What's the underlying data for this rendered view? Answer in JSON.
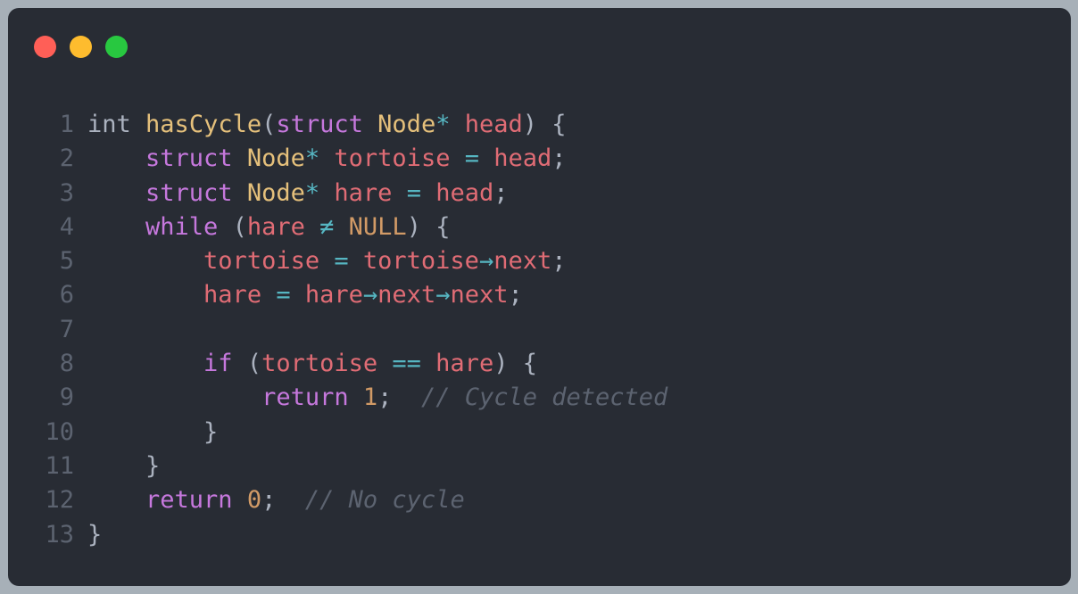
{
  "window": {
    "controls": [
      "close",
      "minimize",
      "maximize"
    ]
  },
  "code": {
    "language": "c",
    "lines": [
      {
        "number": "1",
        "tokens": [
          {
            "t": "int",
            "c": "pl"
          },
          {
            "t": " ",
            "c": "pl"
          },
          {
            "t": "hasCycle",
            "c": "fn"
          },
          {
            "t": "(",
            "c": "pn"
          },
          {
            "t": "struct",
            "c": "kw"
          },
          {
            "t": " ",
            "c": "pl"
          },
          {
            "t": "Node",
            "c": "ty"
          },
          {
            "t": "*",
            "c": "op"
          },
          {
            "t": " ",
            "c": "pl"
          },
          {
            "t": "head",
            "c": "id"
          },
          {
            "t": ") {",
            "c": "pn"
          }
        ]
      },
      {
        "number": "2",
        "tokens": [
          {
            "t": "    ",
            "c": "pl"
          },
          {
            "t": "struct",
            "c": "kw"
          },
          {
            "t": " ",
            "c": "pl"
          },
          {
            "t": "Node",
            "c": "ty"
          },
          {
            "t": "*",
            "c": "op"
          },
          {
            "t": " ",
            "c": "pl"
          },
          {
            "t": "tortoise",
            "c": "id"
          },
          {
            "t": " ",
            "c": "pl"
          },
          {
            "t": "=",
            "c": "op"
          },
          {
            "t": " ",
            "c": "pl"
          },
          {
            "t": "head",
            "c": "id"
          },
          {
            "t": ";",
            "c": "pn"
          }
        ]
      },
      {
        "number": "3",
        "tokens": [
          {
            "t": "    ",
            "c": "pl"
          },
          {
            "t": "struct",
            "c": "kw"
          },
          {
            "t": " ",
            "c": "pl"
          },
          {
            "t": "Node",
            "c": "ty"
          },
          {
            "t": "*",
            "c": "op"
          },
          {
            "t": " ",
            "c": "pl"
          },
          {
            "t": "hare",
            "c": "id"
          },
          {
            "t": " ",
            "c": "pl"
          },
          {
            "t": "=",
            "c": "op"
          },
          {
            "t": " ",
            "c": "pl"
          },
          {
            "t": "head",
            "c": "id"
          },
          {
            "t": ";",
            "c": "pn"
          }
        ]
      },
      {
        "number": "4",
        "tokens": [
          {
            "t": "    ",
            "c": "pl"
          },
          {
            "t": "while",
            "c": "kw"
          },
          {
            "t": " (",
            "c": "pn"
          },
          {
            "t": "hare",
            "c": "id"
          },
          {
            "t": " ",
            "c": "pl"
          },
          {
            "t": "≠",
            "c": "op"
          },
          {
            "t": " ",
            "c": "pl"
          },
          {
            "t": "NULL",
            "c": "nm"
          },
          {
            "t": ") {",
            "c": "pn"
          }
        ]
      },
      {
        "number": "5",
        "tokens": [
          {
            "t": "        ",
            "c": "pl"
          },
          {
            "t": "tortoise",
            "c": "id"
          },
          {
            "t": " ",
            "c": "pl"
          },
          {
            "t": "=",
            "c": "op"
          },
          {
            "t": " ",
            "c": "pl"
          },
          {
            "t": "tortoise",
            "c": "id"
          },
          {
            "t": "→",
            "c": "op"
          },
          {
            "t": "next",
            "c": "id"
          },
          {
            "t": ";",
            "c": "pn"
          }
        ]
      },
      {
        "number": "6",
        "tokens": [
          {
            "t": "        ",
            "c": "pl"
          },
          {
            "t": "hare",
            "c": "id"
          },
          {
            "t": " ",
            "c": "pl"
          },
          {
            "t": "=",
            "c": "op"
          },
          {
            "t": " ",
            "c": "pl"
          },
          {
            "t": "hare",
            "c": "id"
          },
          {
            "t": "→",
            "c": "op"
          },
          {
            "t": "next",
            "c": "id"
          },
          {
            "t": "→",
            "c": "op"
          },
          {
            "t": "next",
            "c": "id"
          },
          {
            "t": ";",
            "c": "pn"
          }
        ]
      },
      {
        "number": "7",
        "tokens": []
      },
      {
        "number": "8",
        "tokens": [
          {
            "t": "        ",
            "c": "pl"
          },
          {
            "t": "if",
            "c": "kw"
          },
          {
            "t": " (",
            "c": "pn"
          },
          {
            "t": "tortoise",
            "c": "id"
          },
          {
            "t": " ",
            "c": "pl"
          },
          {
            "t": "==",
            "c": "op"
          },
          {
            "t": " ",
            "c": "pl"
          },
          {
            "t": "hare",
            "c": "id"
          },
          {
            "t": ") {",
            "c": "pn"
          }
        ]
      },
      {
        "number": "9",
        "tokens": [
          {
            "t": "            ",
            "c": "pl"
          },
          {
            "t": "return",
            "c": "kw"
          },
          {
            "t": " ",
            "c": "pl"
          },
          {
            "t": "1",
            "c": "nm"
          },
          {
            "t": ";  ",
            "c": "pn"
          },
          {
            "t": "// Cycle detected",
            "c": "cm"
          }
        ]
      },
      {
        "number": "10",
        "tokens": [
          {
            "t": "        ",
            "c": "pl"
          },
          {
            "t": "}",
            "c": "pn"
          }
        ]
      },
      {
        "number": "11",
        "tokens": [
          {
            "t": "    ",
            "c": "pl"
          },
          {
            "t": "}",
            "c": "pn"
          }
        ]
      },
      {
        "number": "12",
        "tokens": [
          {
            "t": "    ",
            "c": "pl"
          },
          {
            "t": "return",
            "c": "kw"
          },
          {
            "t": " ",
            "c": "pl"
          },
          {
            "t": "0",
            "c": "nm"
          },
          {
            "t": ";  ",
            "c": "pn"
          },
          {
            "t": "// No cycle",
            "c": "cm"
          }
        ]
      },
      {
        "number": "13",
        "tokens": [
          {
            "t": "}",
            "c": "pn"
          }
        ]
      }
    ]
  }
}
